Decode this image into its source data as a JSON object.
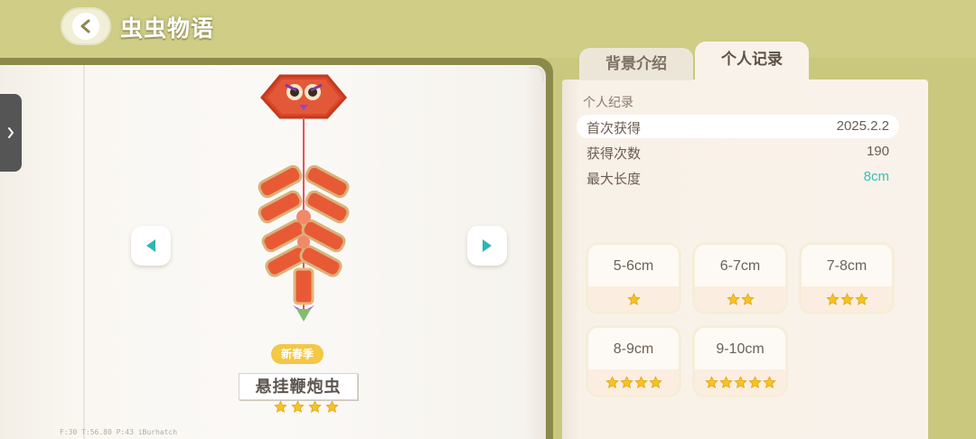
{
  "header": {
    "title": "虫虫物语",
    "back_icon": "back-arrow-icon"
  },
  "book": {
    "season_badge": "新春季",
    "bug_name": "悬挂鞭炮虫",
    "bug_rarity_stars": 4,
    "debug_text": "F:30   T:56.80   P:43   iBurhatch"
  },
  "tabs": [
    {
      "label": "背景介绍",
      "active": false
    },
    {
      "label": "个人记录",
      "active": true
    }
  ],
  "record": {
    "section_title": "个人纪录",
    "stats": [
      {
        "label": "首次获得",
        "value": "2025.2.2"
      },
      {
        "label": "获得次数",
        "value": "190"
      },
      {
        "label": "最大长度",
        "value": "8cm"
      }
    ],
    "size_cards": [
      {
        "range": "5-6cm",
        "stars": 1
      },
      {
        "range": "6-7cm",
        "stars": 2
      },
      {
        "range": "7-8cm",
        "stars": 3
      },
      {
        "range": "8-9cm",
        "stars": 4
      },
      {
        "range": "9-10cm",
        "stars": 5
      }
    ]
  },
  "colors": {
    "background": "#c9c87e",
    "accent_cyan": "#39bfb7",
    "star_yellow": "#f5c325",
    "badge_yellow": "#f4c744"
  }
}
